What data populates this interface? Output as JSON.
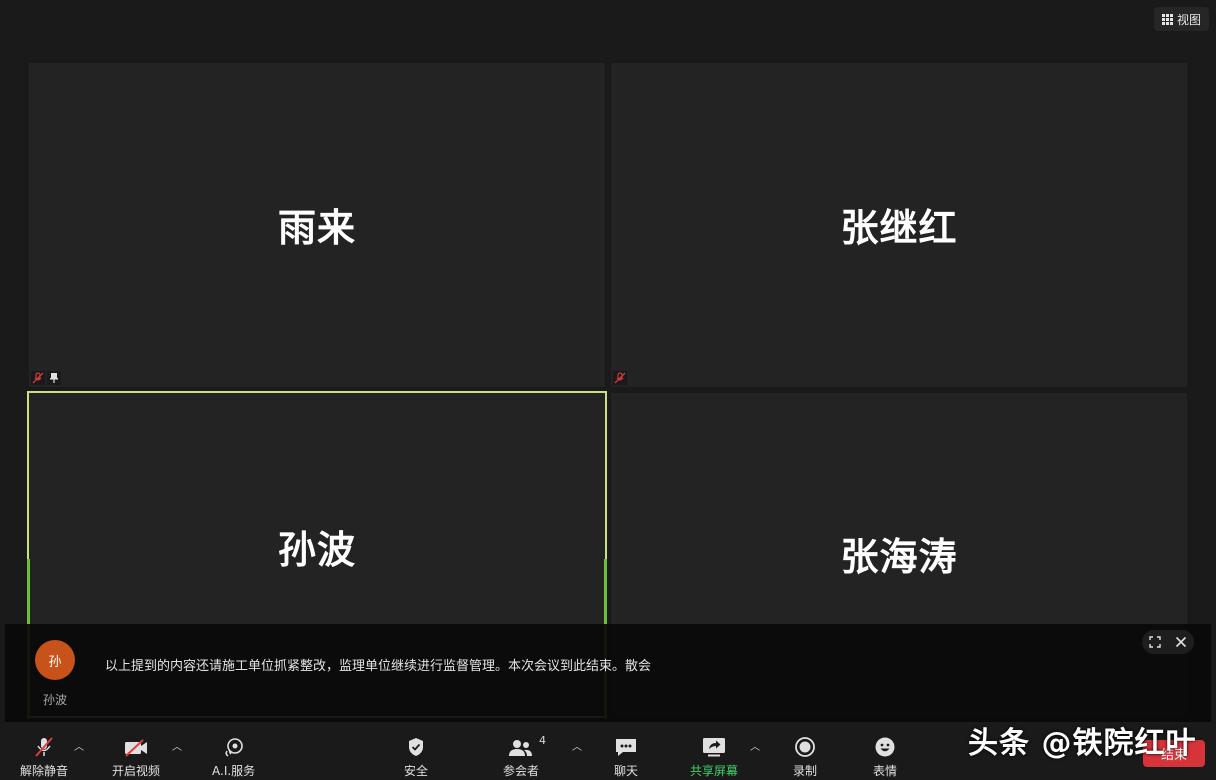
{
  "view_button": {
    "label": "视图",
    "icon": "grid-icon"
  },
  "tiles": [
    {
      "name": "雨来",
      "muted": true,
      "pinned": true
    },
    {
      "name": "张继红",
      "muted": true,
      "pinned": false
    },
    {
      "name": "孙波",
      "muted": false,
      "pinned": false,
      "active_speaker": true
    },
    {
      "name": "张海涛",
      "muted": false,
      "pinned": false
    }
  ],
  "caption": {
    "avatar_initial": "孙",
    "speaker": "孙波",
    "text": "以上提到的内容还请施工单位抓紧整改，监理单位继续进行监督管理。本次会议到此结束。散会"
  },
  "toolbar": {
    "unmute": "解除静音",
    "start_video": "开启视频",
    "ai_service": "A.I.服务",
    "security": "安全",
    "participants": "参会者",
    "participants_count": "4",
    "chat": "聊天",
    "share_screen": "共享屏幕",
    "record": "录制",
    "reactions": "表情",
    "leave": "结束"
  },
  "watermark": "头条 @铁院红叶",
  "colors": {
    "active_border": "#c9e27e",
    "share_green": "#3fd16a",
    "leave_red": "#d6333a",
    "avatar": "#c7531a"
  }
}
